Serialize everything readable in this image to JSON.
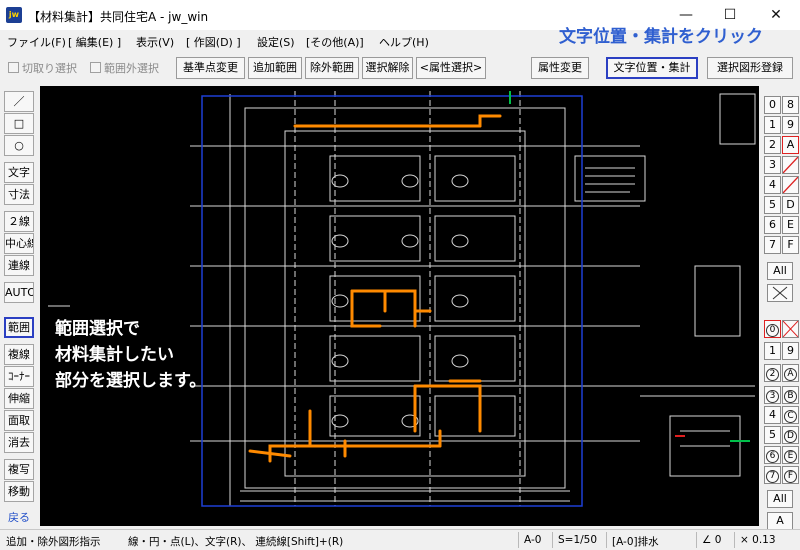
{
  "window": {
    "app_icon": "jw",
    "title": "【材料集計】共同住宅A - jw_win",
    "minimize": "—",
    "maximize": "☐",
    "close": "✕"
  },
  "annotations": {
    "top": "文字位置・集計をクリック",
    "instruction": [
      "範囲選択で",
      "材料集計したい",
      "部分を選択します。"
    ]
  },
  "menu": [
    "ファイル(F)",
    "[ 編集(E) ]",
    "表示(V)",
    "[ 作図(D) ]",
    "設定(S)",
    "[その他(A)]",
    "ヘルプ(H)"
  ],
  "toolbar": {
    "cut_select": "切取り選択",
    "outside_select": "範囲外選択",
    "base_point_change": "基準点変更",
    "add_range": "追加範囲",
    "exclude_range": "除外範囲",
    "release_selection": "選択解除",
    "attribute_select": "<属性選択>",
    "attribute_change": "属性変更",
    "text_position_total": "文字位置・集計",
    "register_shape": "選択図形登録"
  },
  "left_tools": [
    "／",
    "□",
    "○",
    "文字",
    "寸法",
    "２線",
    "中心線",
    "連線",
    "AUTO",
    "範囲",
    "複線",
    "ｺｰﾅｰ",
    "伸縮",
    "面取",
    "消去",
    "複写",
    "移動",
    "戻る"
  ],
  "right_layers": {
    "group1_left": [
      "0",
      "1",
      "2",
      "3",
      "4",
      "5",
      "6",
      "7"
    ],
    "group1_right": [
      "8",
      "9",
      "A",
      "",
      "",
      "D",
      "E",
      "F"
    ],
    "all1": "All",
    "group2_left": [
      "0",
      "1",
      "2",
      "3",
      "4",
      "5",
      "6",
      "7"
    ],
    "group2_right": [
      "",
      "9",
      "A",
      "B",
      "C",
      "D",
      "E",
      "F"
    ],
    "all2": "All",
    "bottom": "A"
  },
  "status": {
    "mode": "追加・除外図形指示",
    "hint": "線・円・点(L)、文字(R)、 連続線[Shift]+(R)",
    "layer": "A-0",
    "scale": "S=1/50",
    "layer_name": "[A-0]排水",
    "angle": "∠ 0",
    "zoom": "× 0.13"
  },
  "colors": {
    "highlight_border": "#2b3fc2",
    "callout_blue": "#2f5fd0",
    "pipe_orange": "#ff8a00",
    "selection_blue": "#1d3fd6"
  }
}
